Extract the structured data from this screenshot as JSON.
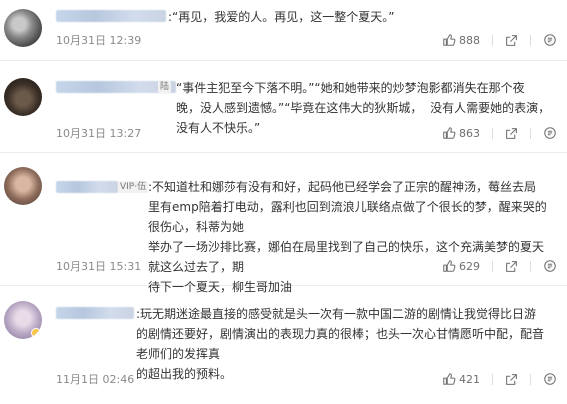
{
  "comments": [
    {
      "text": ":“再见，我爱的人。再见，这一整个夏天。”",
      "time": "10月31日 12:39",
      "likes": "888",
      "user_tag": ""
    },
    {
      "text": "“事件主犯至今下落不明。”“她和她带来的炒梦泡影都消失在那个夜\n晚，没人感到遗憾。”“毕竟在这伟大的狄斯城，  没有人需要她的表演，没有人不快乐。”",
      "time": "10月31日 13:27",
      "likes": "863",
      "user_tag": "陆"
    },
    {
      "text": ":不知道杜和娜莎有没有和好，起码他已经学会了正宗的醒神汤，莓丝去局\n里有emp陪着打电动，露利也回到流浪儿联络点做了个很长的梦，醒来哭的很伤心，科蒂为她\n举办了一场沙排比赛，娜伯在局里找到了自己的快乐，这个充满美梦的夏天就这么过去了，期\n待下一个夏天，柳生哥加油",
      "time": "10月31日 15:31",
      "likes": "629",
      "user_tag": "VIP·伍"
    },
    {
      "text": ":玩无期迷途最直接的感受就是头一次有一款中国二游的剧情让我觉得比日游\n的剧情还要好，剧情演出的表现力真的很棒；也头一次心甘情愿听中配，配音老师们的发挥真\n的超出我的预料。",
      "time": "11月1日 02:46",
      "likes": "421",
      "user_tag": ""
    }
  ],
  "icons": {
    "like": "thumbs-up-icon",
    "share": "share-icon",
    "comment": "comment-icon"
  },
  "colors": {
    "text": "#333333",
    "meta": "#8a8a8a",
    "username_blur": "#c6d6ea"
  }
}
